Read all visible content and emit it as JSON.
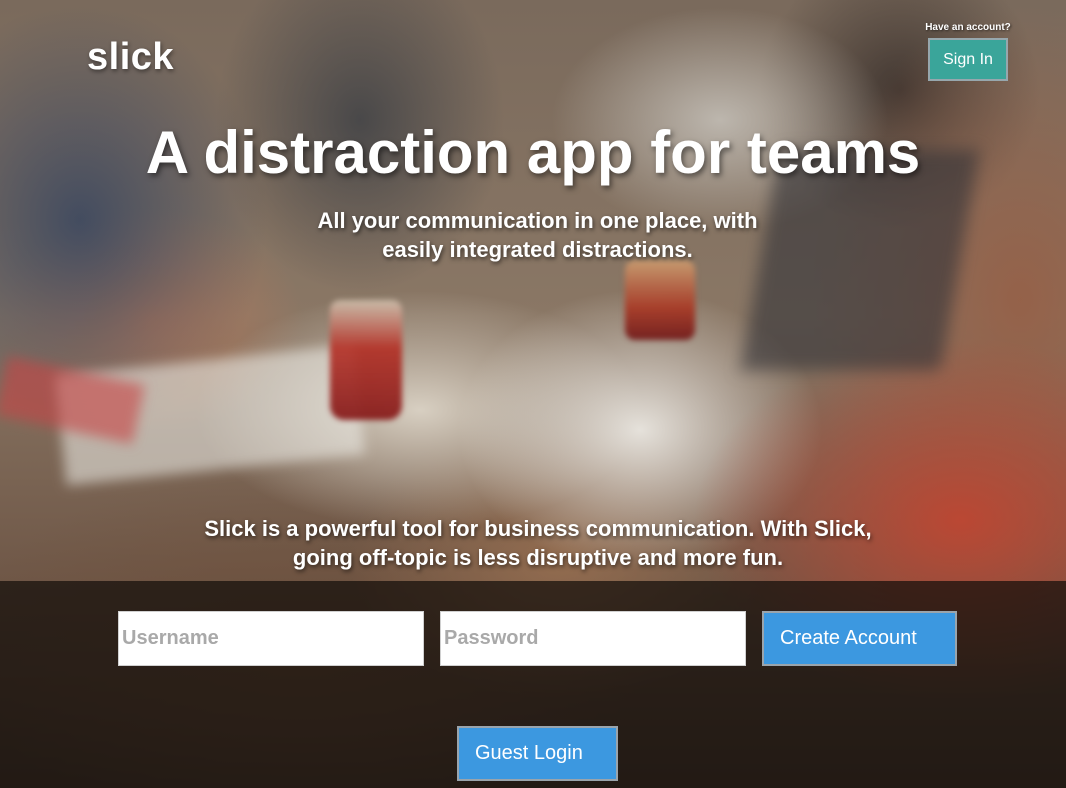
{
  "header": {
    "logo": "slick",
    "account_prompt": "Have an account?",
    "signin_label": "Sign In"
  },
  "hero": {
    "headline": "A distraction app for teams",
    "subheadline": "All your communication in one place, with easily integrated distractions.",
    "description": "Slick is a powerful tool for business communication. With Slick, going off-topic is less disruptive and more fun."
  },
  "form": {
    "username_placeholder": "Username",
    "password_placeholder": "Password",
    "create_account_label": "Create Account",
    "guest_login_label": "Guest Login"
  },
  "colors": {
    "signin_button": "#3aa59a",
    "primary_button": "#3c98e0",
    "text": "#ffffff"
  }
}
